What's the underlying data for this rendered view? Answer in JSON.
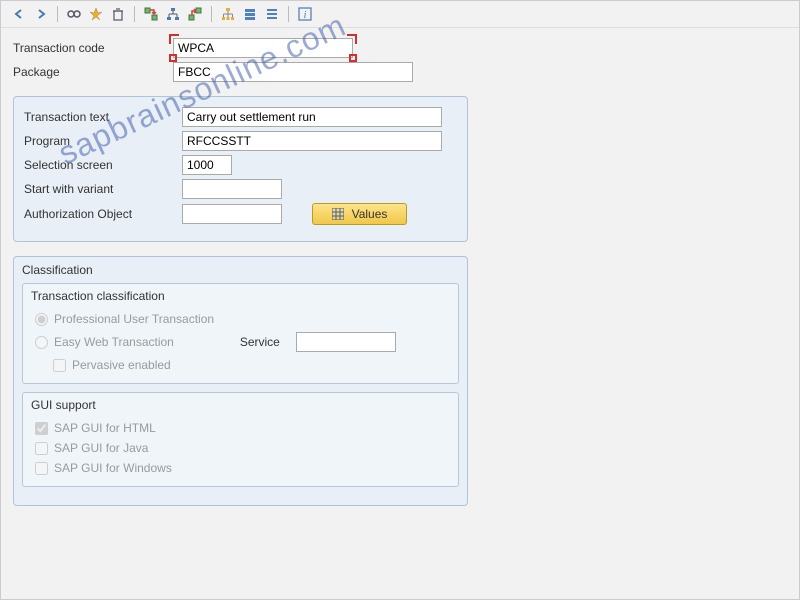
{
  "watermark": "sapbrainsonline.com",
  "toolbar": {
    "back": "←",
    "forward": "→",
    "glasses": "👓",
    "wand": "✨",
    "trash": "🗑",
    "import": "↘",
    "hierarchy": "🏗",
    "export": "↗",
    "tree": "🌳",
    "stack": "📑",
    "layers": "≣",
    "info": "ℹ"
  },
  "fields": {
    "tcode_label": "Transaction code",
    "tcode_value": "WPCA",
    "package_label": "Package",
    "package_value": "FBCC"
  },
  "details": {
    "ttext_label": "Transaction text",
    "ttext_value": "Carry out settlement run",
    "program_label": "Program",
    "program_value": "RFCCSSTT",
    "selscreen_label": "Selection screen",
    "selscreen_value": "1000",
    "variant_label": "Start with variant",
    "variant_value": "",
    "authobj_label": "Authorization Object",
    "authobj_value": "",
    "values_btn": "Values"
  },
  "classification": {
    "title": "Classification",
    "trans_class_title": "Transaction classification",
    "prof_label": "Professional User Transaction",
    "easy_label": "Easy Web Transaction",
    "service_label": "Service",
    "service_value": "",
    "pervasive_label": "Pervasive enabled",
    "gui_title": "GUI support",
    "gui_html": "SAP GUI for HTML",
    "gui_java": "SAP GUI for Java",
    "gui_win": "SAP GUI for Windows"
  }
}
